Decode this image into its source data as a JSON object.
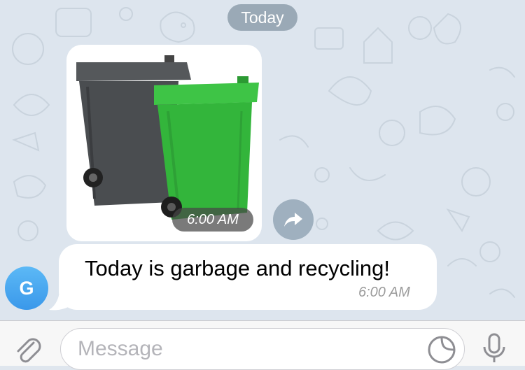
{
  "chat": {
    "date_separator": "Today",
    "photo_message": {
      "time": "6:00 AM",
      "image_desc_icon": "garbage-bins-photo"
    },
    "text_message": {
      "text": "Today is garbage and recycling!",
      "time": "6:00 AM"
    },
    "sender_avatar_initial": "G"
  },
  "input": {
    "placeholder": "Message"
  },
  "icons": {
    "forward": "forward-icon",
    "attach": "paperclip-icon",
    "sticker": "sticker-icon",
    "mic": "microphone-icon"
  },
  "colors": {
    "chat_background": "#dde5ee",
    "bubble": "#ffffff",
    "avatar": "#48a8ef",
    "date_pill": "#9aa9b6",
    "bin_green": "#33b53b",
    "bin_dark": "#4a4d50"
  }
}
